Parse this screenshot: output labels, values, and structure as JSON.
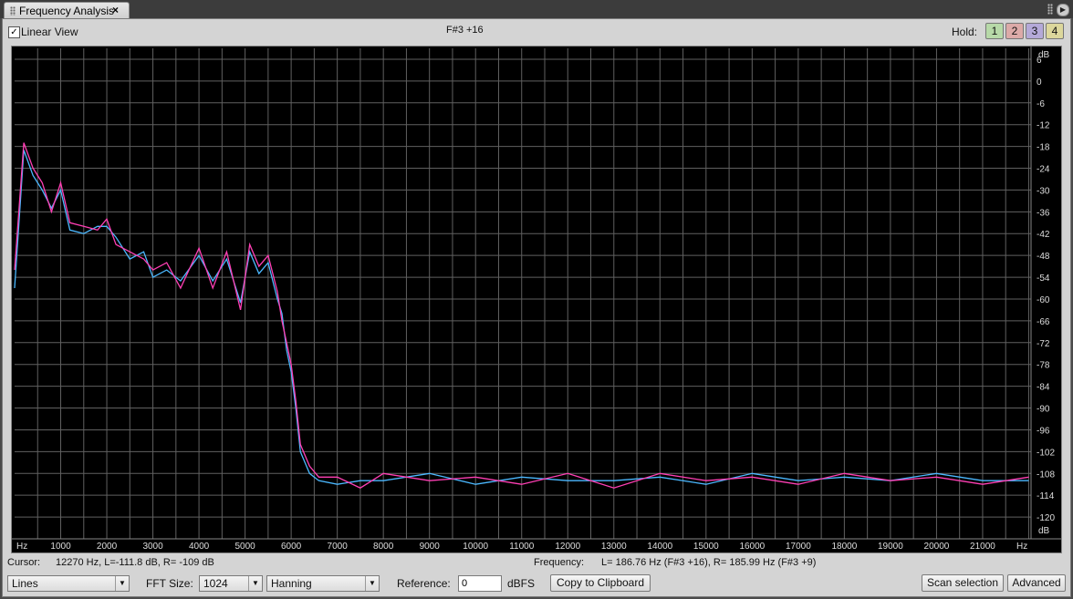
{
  "tab": {
    "title": "Frequency Analysis",
    "close": "×",
    "menu": "▶"
  },
  "toolbar": {
    "linear_view_label": "Linear View",
    "linear_view_checked": "✓",
    "note": "F#3 +16",
    "hold_label": "Hold:"
  },
  "hold_buttons": [
    {
      "label": "1",
      "color": "#b7d9a8"
    },
    {
      "label": "2",
      "color": "#dcaaa8"
    },
    {
      "label": "3",
      "color": "#b4a9d8"
    },
    {
      "label": "4",
      "color": "#dcd79c"
    }
  ],
  "status": {
    "cursor_label": "Cursor:",
    "cursor_value": "12270 Hz, L=-111.8 dB, R=  -109 dB",
    "frequency_label": "Frequency:",
    "frequency_value": "L= 186.76 Hz (F#3 +16), R= 185.99 Hz (F#3 +9)"
  },
  "controls": {
    "display_mode": "Lines",
    "fft_label": "FFT Size:",
    "fft_size": "1024",
    "window": "Hanning",
    "reference_label": "Reference:",
    "reference_value": "0",
    "reference_unit": "dBFS",
    "copy_label": "Copy to Clipboard",
    "scan_label": "Scan selection",
    "advanced_label": "Advanced"
  },
  "colors": {
    "left_channel": "#ff3fb4",
    "right_channel": "#4bb8ff",
    "grid": "#606060",
    "plot_bg": "#000000"
  },
  "chart_data": {
    "type": "line",
    "xlabel": "Hz",
    "ylabel": "dB",
    "x_ticks": [
      "1000",
      "2000",
      "3000",
      "4000",
      "5000",
      "6000",
      "7000",
      "8000",
      "9000",
      "10000",
      "11000",
      "12000",
      "13000",
      "14000",
      "15000",
      "16000",
      "17000",
      "18000",
      "19000",
      "20000",
      "21000"
    ],
    "y_ticks": [
      "6",
      "0",
      "-6",
      "-12",
      "-18",
      "-24",
      "-30",
      "-36",
      "-42",
      "-48",
      "-54",
      "-60",
      "-66",
      "-72",
      "-78",
      "-84",
      "-90",
      "-96",
      "-102",
      "-108",
      "-114",
      "-120"
    ],
    "xlim": [
      0,
      22050
    ],
    "ylim": [
      -126,
      9
    ],
    "grid": true,
    "series": [
      {
        "name": "L",
        "color": "#ff3fb4",
        "x": [
          0,
          200,
          400,
          600,
          800,
          1000,
          1200,
          1500,
          1800,
          2000,
          2200,
          2500,
          2800,
          3000,
          3300,
          3600,
          4000,
          4300,
          4600,
          4900,
          5100,
          5300,
          5500,
          5700,
          5800,
          5900,
          6000,
          6100,
          6200,
          6400,
          6600,
          7000,
          7500,
          8000,
          9000,
          10000,
          11000,
          12000,
          13000,
          14000,
          15000,
          16000,
          17000,
          18000,
          19000,
          20000,
          21000,
          22000
        ],
        "y": [
          -52,
          -17,
          -24,
          -28,
          -36,
          -28,
          -39,
          -40,
          -41,
          -38,
          -45,
          -47,
          -49,
          -52,
          -50,
          -57,
          -46,
          -57,
          -47,
          -63,
          -45,
          -51,
          -48,
          -58,
          -66,
          -72,
          -78,
          -88,
          -100,
          -106,
          -109,
          -109,
          -112,
          -108,
          -110,
          -109,
          -111,
          -108,
          -112,
          -108,
          -110,
          -109,
          -111,
          -108,
          -110,
          -109,
          -111,
          -109
        ]
      },
      {
        "name": "R",
        "color": "#4bb8ff",
        "x": [
          0,
          200,
          400,
          600,
          800,
          1000,
          1200,
          1500,
          1800,
          2000,
          2200,
          2500,
          2800,
          3000,
          3300,
          3600,
          4000,
          4300,
          4600,
          4900,
          5100,
          5300,
          5500,
          5700,
          5800,
          5900,
          6000,
          6100,
          6200,
          6400,
          6600,
          7000,
          7500,
          8000,
          9000,
          10000,
          11000,
          12000,
          13000,
          14000,
          15000,
          16000,
          17000,
          18000,
          19000,
          20000,
          21000,
          22000
        ],
        "y": [
          -57,
          -19,
          -26,
          -30,
          -35,
          -30,
          -41,
          -42,
          -40,
          -40,
          -43,
          -49,
          -47,
          -54,
          -52,
          -55,
          -48,
          -55,
          -49,
          -61,
          -47,
          -53,
          -50,
          -60,
          -64,
          -74,
          -80,
          -90,
          -102,
          -108,
          -110,
          -111,
          -110,
          -110,
          -108,
          -111,
          -109,
          -110,
          -110,
          -109,
          -111,
          -108,
          -110,
          -109,
          -110,
          -108,
          -110,
          -110
        ]
      }
    ]
  }
}
